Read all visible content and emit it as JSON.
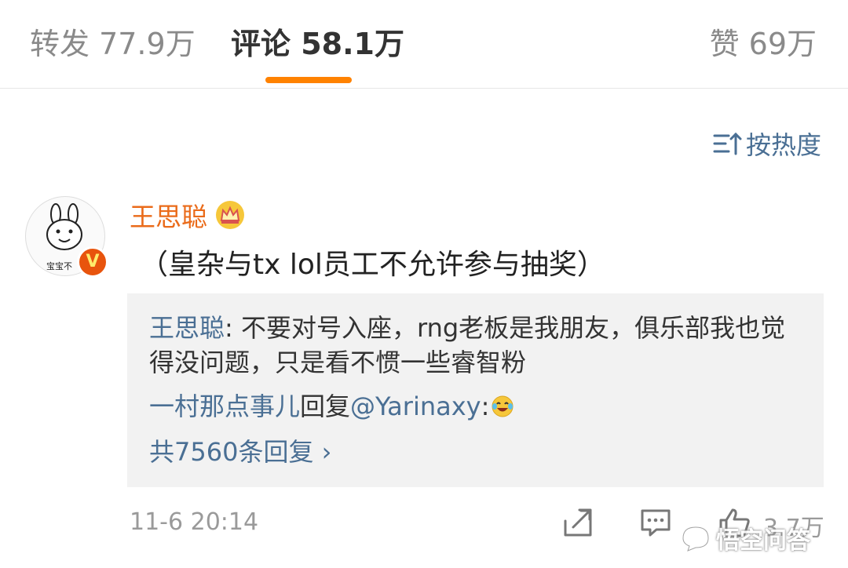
{
  "tabs": {
    "repost": "转发 77.9万",
    "comment": "评论 58.1万",
    "like": "赞 69万"
  },
  "sort": {
    "label": "按热度",
    "icon": "sort-icon"
  },
  "comment": {
    "author": "王思聪",
    "avatar_caption": "宝宝不",
    "verified_badge": "V",
    "text": "（皇杂与tx lol员工不允许参与抽奖）",
    "time": "11-6 20:14",
    "like_count": "3.7万"
  },
  "replies": [
    {
      "user": "王思聪",
      "sep": ": ",
      "text": "不要对号入座，rng老板是我朋友，俱乐部我也觉得没问题，只是看不惯一些睿智粉"
    },
    {
      "user": "一村那点事儿",
      "verb": "回复",
      "mention": "@Yarinaxy",
      "sep": ":",
      "emoji": "laughing-tears-emoji"
    }
  ],
  "more_replies": "共7560条回复 ›",
  "watermark": "悟空问答",
  "colors": {
    "accent": "#ff8200",
    "author": "#ea6b1a",
    "link": "#4a6f94",
    "reply_bg": "#f2f2f2"
  }
}
